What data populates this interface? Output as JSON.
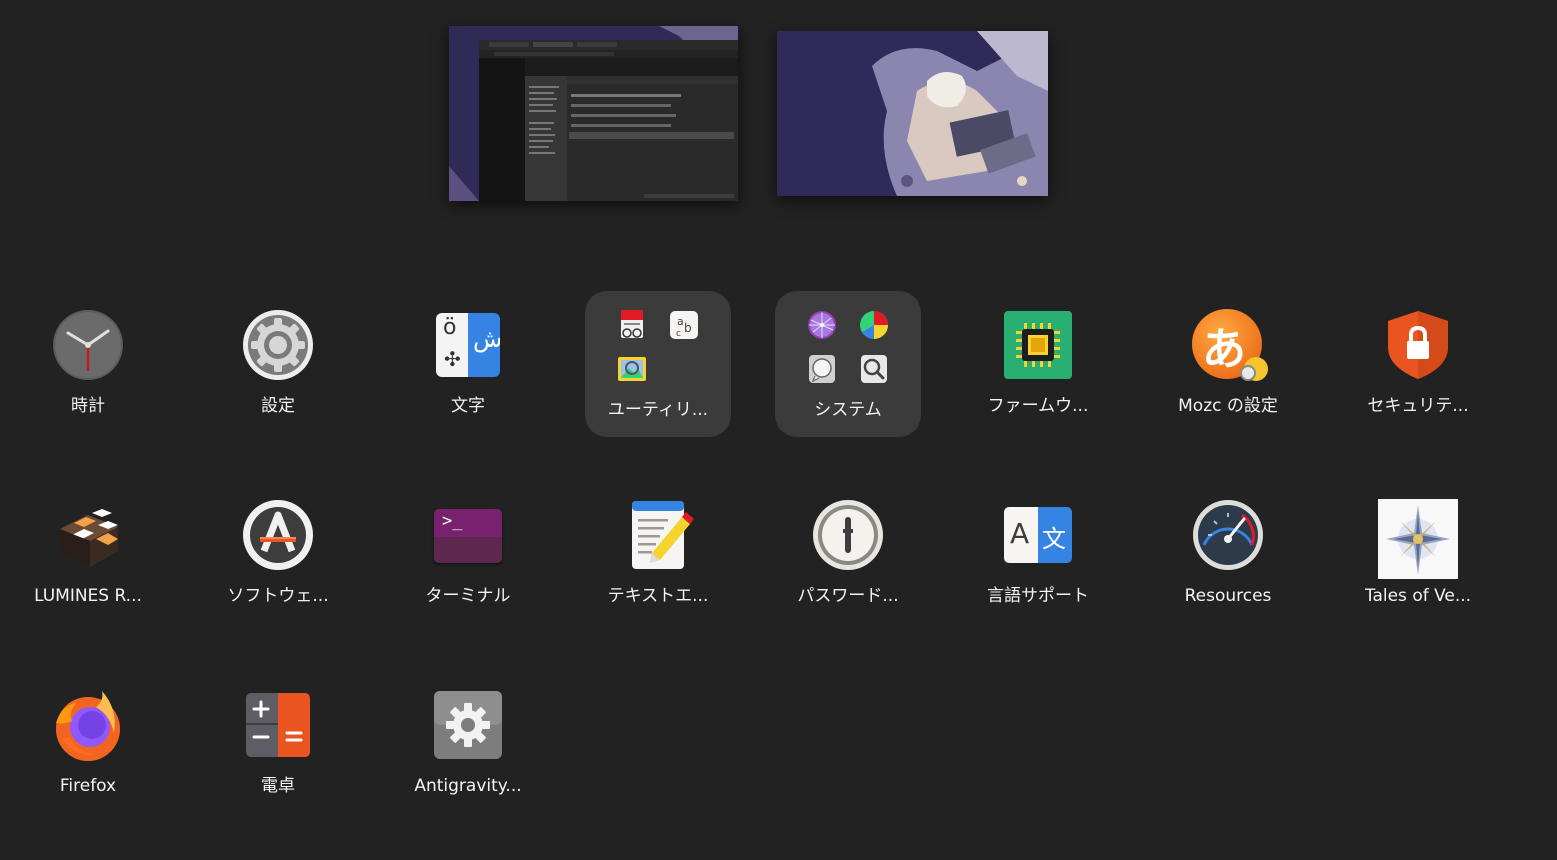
{
  "workspaces": [
    {
      "name": "workspace-1"
    },
    {
      "name": "workspace-2"
    }
  ],
  "apps": [
    {
      "id": "clock",
      "label": "時計"
    },
    {
      "id": "settings",
      "label": "設定"
    },
    {
      "id": "characters",
      "label": "文字"
    },
    {
      "id": "utilities-folder",
      "label": "ユーティリ..."
    },
    {
      "id": "system-folder",
      "label": "システム"
    },
    {
      "id": "firmware",
      "label": "ファームウ..."
    },
    {
      "id": "mozc-settings",
      "label": "Mozc の設定"
    },
    {
      "id": "security",
      "label": "セキュリテ..."
    },
    {
      "id": "lumines",
      "label": "LUMINES R..."
    },
    {
      "id": "software",
      "label": "ソフトウェ..."
    },
    {
      "id": "terminal",
      "label": "ターミナル"
    },
    {
      "id": "text-editor",
      "label": "テキストエ..."
    },
    {
      "id": "passwords",
      "label": "パスワード..."
    },
    {
      "id": "language-support",
      "label": "言語サポート"
    },
    {
      "id": "resources",
      "label": "Resources"
    },
    {
      "id": "tales-of-vesperia",
      "label": "Tales of Ve..."
    },
    {
      "id": "firefox",
      "label": "Firefox"
    },
    {
      "id": "calculator",
      "label": "電卓"
    },
    {
      "id": "antigravity",
      "label": "Antigravity..."
    }
  ],
  "icons": {
    "terminal_prompt": ">_",
    "mozc_glyph": "あ",
    "language_a": "A",
    "language_kanji": "文",
    "characters_latin": "ö",
    "characters_arabic": "ش"
  },
  "colors": {
    "background": "#222222",
    "folder_tile": "#3b3b3b",
    "text": "#f4f4f4"
  }
}
